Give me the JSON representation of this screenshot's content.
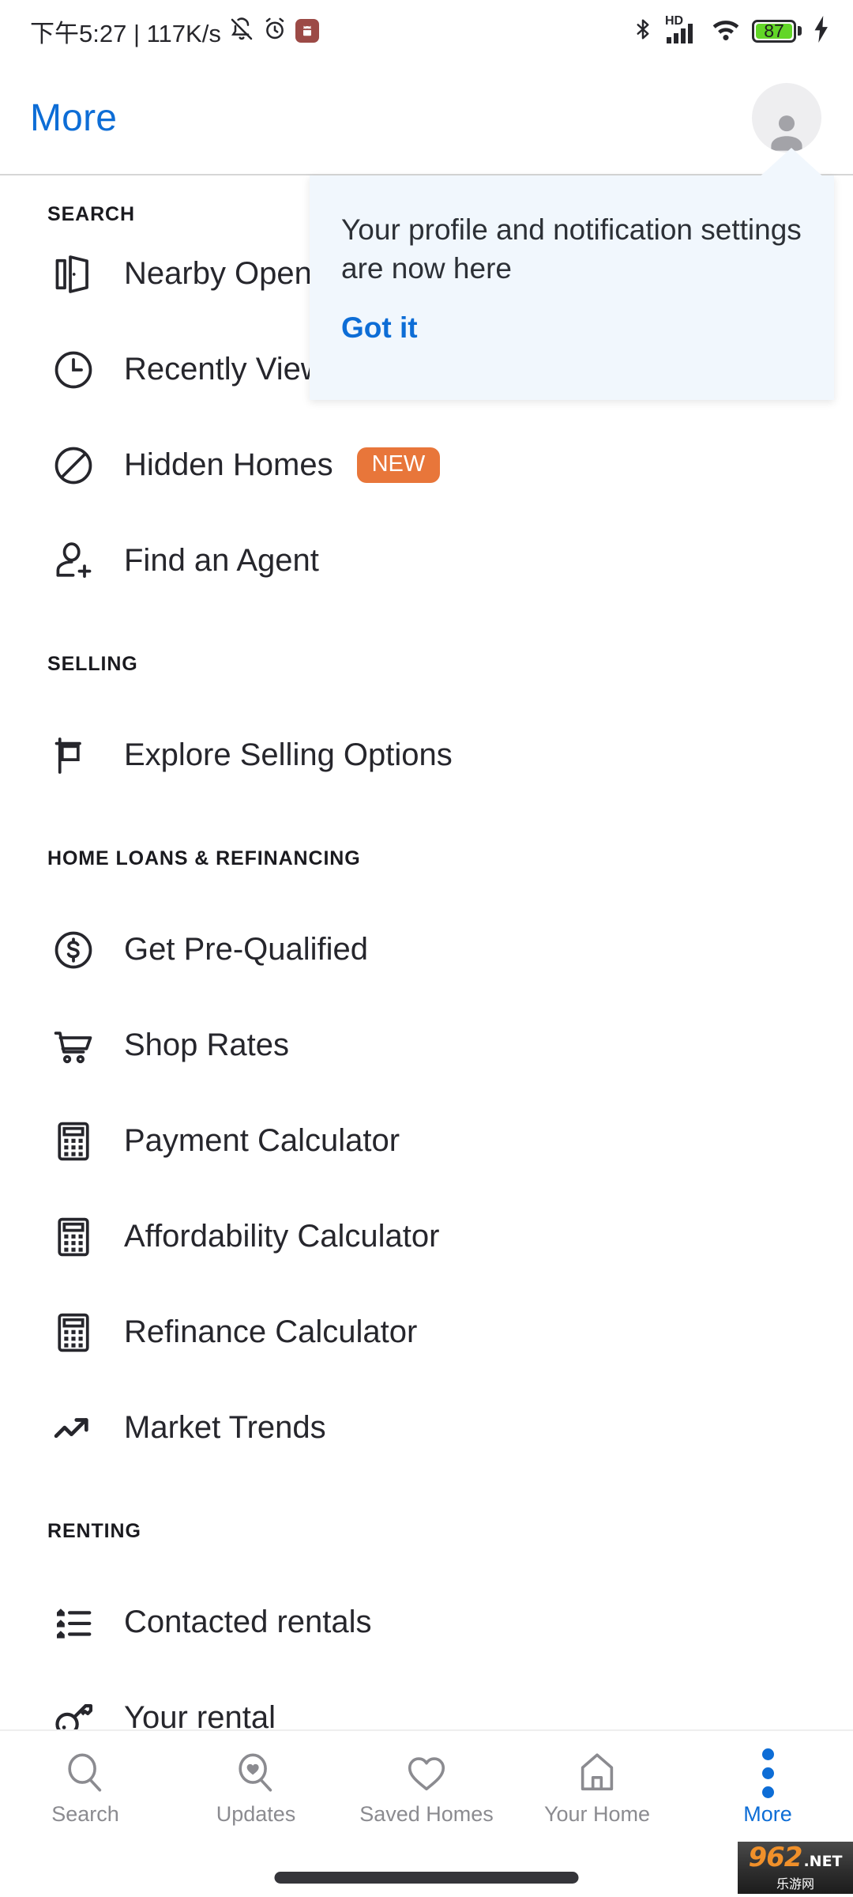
{
  "status_bar": {
    "clock": "下午5:27 | 117K/s",
    "left_icons": [
      "bell-off-icon",
      "alarm-icon",
      "android-app-icon"
    ],
    "right_icons": [
      "bluetooth-icon",
      "hd-signal-icon",
      "wifi-icon",
      "battery-icon",
      "charging-bolt-icon"
    ],
    "signal_label": "HD",
    "battery_level": "87"
  },
  "header": {
    "title": "More",
    "title_color": "#0d6dd6",
    "avatar_icon": "profile-avatar-icon"
  },
  "tooltip": {
    "message": "Your profile and notification settings are now here",
    "cta_label": "Got it",
    "background": "#f1f7fd",
    "cta_color": "#0d6dd6"
  },
  "sections": [
    {
      "header": "SEARCH",
      "items": [
        {
          "label": "Nearby Open Houses",
          "icon": "open-door-icon",
          "badge": null
        },
        {
          "label": "Recently Viewed",
          "icon": "clock-icon",
          "badge": null
        },
        {
          "label": "Hidden Homes",
          "icon": "circle-slash-icon",
          "badge": "NEW"
        },
        {
          "label": "Find an Agent",
          "icon": "person-plus-icon",
          "badge": null
        }
      ]
    },
    {
      "header": "SELLING",
      "items": [
        {
          "label": "Explore Selling Options",
          "icon": "for-sale-sign-icon",
          "badge": null
        }
      ]
    },
    {
      "header": "HOME LOANS & REFINANCING",
      "items": [
        {
          "label": "Get Pre-Qualified",
          "icon": "dollar-circle-icon",
          "badge": null
        },
        {
          "label": "Shop Rates",
          "icon": "shopping-cart-icon",
          "badge": null
        },
        {
          "label": "Payment Calculator",
          "icon": "calculator-icon",
          "badge": null
        },
        {
          "label": "Affordability Calculator",
          "icon": "calculator-icon",
          "badge": null
        },
        {
          "label": "Refinance Calculator",
          "icon": "calculator-icon",
          "badge": null
        },
        {
          "label": "Market Trends",
          "icon": "trending-up-icon",
          "badge": null
        }
      ]
    },
    {
      "header": "RENTING",
      "items": [
        {
          "label": "Contacted rentals",
          "icon": "house-list-icon",
          "badge": null
        },
        {
          "label": "Your rental",
          "icon": "key-icon",
          "badge": null
        }
      ]
    }
  ],
  "badge_color": "#e8763a",
  "bottom_nav": {
    "items": [
      {
        "label": "Search",
        "icon": "magnifier-icon",
        "active": false
      },
      {
        "label": "Updates",
        "icon": "magnifier-heart-icon",
        "active": false
      },
      {
        "label": "Saved Homes",
        "icon": "heart-icon",
        "active": false
      },
      {
        "label": "Your Home",
        "icon": "house-icon",
        "active": false
      },
      {
        "label": "More",
        "icon": "three-dots-icon",
        "active": true
      }
    ]
  },
  "watermark": {
    "number": "962",
    "domain": ".NET",
    "chinese": "乐游网"
  }
}
